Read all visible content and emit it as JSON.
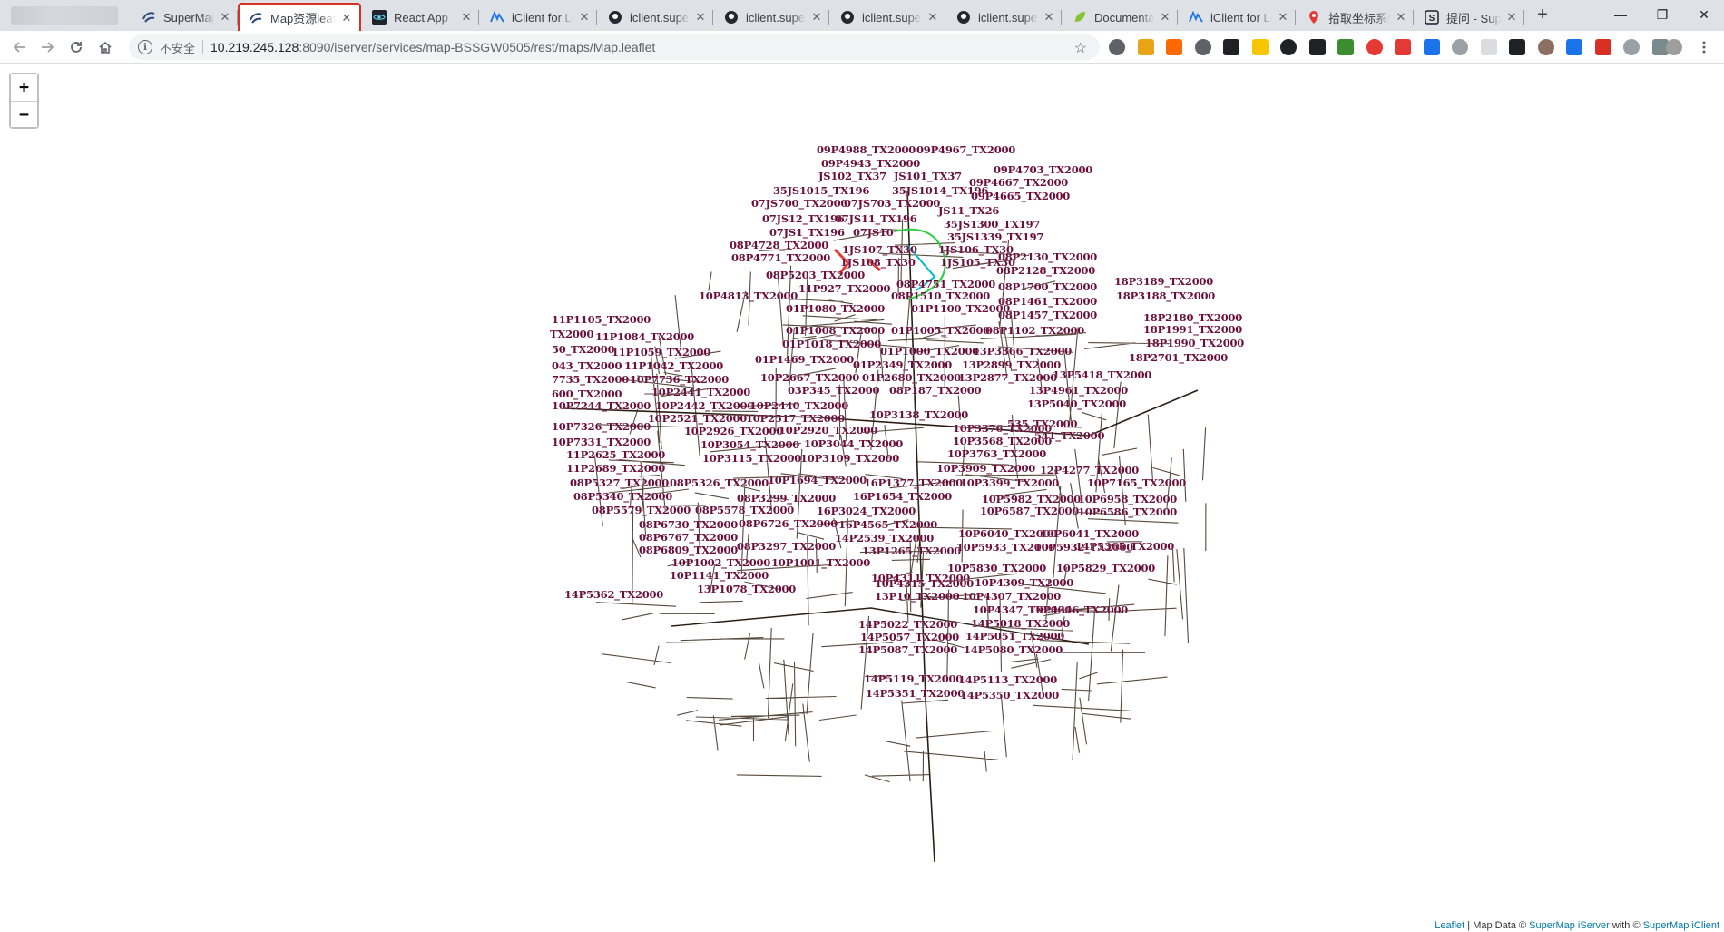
{
  "browser": {
    "tabs": [
      {
        "title": "SuperMap i",
        "favicon": "supermap-icon",
        "active": false
      },
      {
        "title": "Map资源leaflet",
        "favicon": "supermap-icon",
        "active": true
      },
      {
        "title": "React App",
        "favicon": "react-icon",
        "active": false
      },
      {
        "title": "iClient for Leaflet",
        "favicon": "iclient-icon",
        "active": false
      },
      {
        "title": "iclient.supermap",
        "favicon": "github-icon",
        "active": false
      },
      {
        "title": "iclient.supermap",
        "favicon": "github-icon",
        "active": false
      },
      {
        "title": "iclient.supermap",
        "favicon": "github-icon",
        "active": false
      },
      {
        "title": "iclient.supermap",
        "favicon": "github-icon",
        "active": false
      },
      {
        "title": "Documentation",
        "favicon": "leaf-icon",
        "active": false
      },
      {
        "title": "iClient for Leaflet",
        "favicon": "iclient-icon",
        "active": false
      },
      {
        "title": "拾取坐标系统",
        "favicon": "map-pin-icon",
        "active": false
      },
      {
        "title": "提问 - SuperMap",
        "favicon": "s-icon",
        "active": false
      }
    ],
    "new_tab": "+",
    "window_controls": {
      "minimize": "—",
      "restore": "❐",
      "close": "✕"
    }
  },
  "toolbar": {
    "security_label": "不安全",
    "url_host": "10.219.245.128",
    "url_rest": ":8090/iserver/services/map-BSSGW0505/rest/maps/Map.leaflet",
    "extension_colors": [
      "#5f6368",
      "#e8a317",
      "#ff6a00",
      "#5f6368",
      "#202124",
      "#f6c700",
      "#202124",
      "#202124",
      "#3c8d2f",
      "#e53935",
      "#e53935",
      "#1a73e8",
      "#9aa0a6",
      "#dadce0",
      "#202124",
      "#8d6e63",
      "#1a73e8",
      "#d93025",
      "#9aa0a6",
      "#7b8a8b"
    ]
  },
  "map": {
    "zoom_in": "+",
    "zoom_out": "−",
    "label_color": "#6b0f3a",
    "labels": [
      "09P4988_TX2000",
      "09P4967_TX2000",
      "09P4943_TX2000",
      "09P4703_TX2000",
      "JS102_TX37",
      "JS101_TX37",
      "09P4667_TX2000",
      "35JS1015_TX196",
      "35JS1014_TX196",
      "09P4665_TX2000",
      "07JS700_TX2000",
      "07JS703_TX2000",
      "JS11_TX26",
      "07JS12_TX196",
      "07JS11_TX196",
      "35JS1300_TX197",
      "07JS1_TX196",
      "07JS10",
      "35JS1339_TX197",
      "08P4728_TX2000",
      "1JS107_TX30",
      "1JS106_TX30",
      "08P4771_TX2000",
      "1JS108_TX30",
      "1JS105_TX30",
      "08P2130_TX2000",
      "08P5203_TX2000",
      "08P2128_TX2000",
      "18P3189_TX2000",
      "11P927_TX2000",
      "08P4751_TX2000",
      "08P1700_TX2000",
      "10P4813_TX2000",
      "08P1510_TX2000",
      "18P3188_TX2000",
      "01P1080_TX2000",
      "01P1100_TX2000",
      "08P1461_TX2000",
      "11P1105_TX2000",
      "08P1457_TX2000",
      "18P2180_TX2000",
      "TX2000",
      "01P1008_TX2000",
      "01P1005_TX2000",
      "08P1102_TX2000",
      "18P1991_TX2000",
      "11P1084_TX2000",
      "01P1018_TX2000",
      "18P1990_TX2000",
      "50_TX2000",
      "11P1059_TX2000",
      "01P1000_TX2000",
      "13P3366_TX2000",
      "18P2701_TX2000",
      "043_TX2000",
      "11P1042_TX2000",
      "01P1469_TX2000",
      "01P2349_TX2000",
      "13P2899_TX2000",
      "7735_TX2000",
      "10P7736_TX2000",
      "13P5418_TX2000",
      "10P2667_TX2000",
      "01P2680_TX2000",
      "13P2877_TX2000",
      "600_TX2000",
      "10P2441_TX2000",
      "03P345_TX2000",
      "08P187_TX2000",
      "13P4961_TX2000",
      "10P7244_TX2000",
      "10P2442_TX2000",
      "10P2440_TX2000",
      "13P5040_TX2000",
      "10P2521_TX2000",
      "10P2517_TX2000",
      "10P3138_TX2000",
      "10P7326_TX2000",
      "10P2926_TX2000",
      "10P2920_TX2000",
      "10P3376_TX2000",
      "535_TX2000",
      "10P7331_TX2000",
      "10P3054_TX2000",
      "10P3044_TX2000",
      "10P3568_TX2000",
      "541_TX2000",
      "11P2625_TX2000",
      "10P3115_TX2000",
      "10P3109_TX2000",
      "10P3763_TX2000",
      "11P2689_TX2000",
      "10P3909_TX2000",
      "12P4277_TX2000",
      "08P5327_TX2000",
      "08P5326_TX2000",
      "10P1694_TX2000",
      "16P1377_TX2000",
      "10P3399_TX2000",
      "10P7165_TX2000",
      "08P5340_TX2000",
      "08P3299_TX2000",
      "16P1654_TX2000",
      "10P5982_TX2000",
      "10P6958_TX2000",
      "08P5579_TX2000",
      "08P5578_TX2000",
      "16P3024_TX2000",
      "10P6587_TX2000",
      "10P6586_TX2000",
      "08P6730_TX2000",
      "08P6726_TX2000",
      "16P4565_TX2000",
      "08P6767_TX2000",
      "14P2539_TX2000",
      "10P6040_TX2000",
      "10P6041_TX2000",
      "08P3297_TX2000",
      "13P1265_TX2000",
      "10P5933_TX2000",
      "10P5932_TX2000",
      "08P6809_TX2000",
      "10P1002_TX2000",
      "10P1001_TX2000",
      "10P5830_TX2000",
      "10P5829_TX2000",
      "10P1141_TX2000",
      "10P4311_TX2000",
      "10P4309_TX2000",
      "13P1078_TX2000",
      "10P4315_TX2000",
      "10P4307_TX2000",
      "13P10_TX2000",
      "10P4347_TX2000",
      "10P4346_TX2000",
      "14P5022_TX2000",
      "14P5018_TX2000",
      "14P5057_TX2000",
      "14P5051_TX2000",
      "14P5087_TX2000",
      "14P5080_TX2000",
      "14P5119_TX2000",
      "14P5113_TX2000",
      "14P5351_TX2000",
      "14P5350_TX2000",
      "14P5365_TX2000",
      "14P5362_TX2000"
    ]
  },
  "attribution": {
    "leaflet": "Leaflet",
    "sep": " | Map Data © ",
    "iserver": "SuperMap iServer",
    "with": " with © ",
    "iclient": "SuperMap iClient"
  }
}
